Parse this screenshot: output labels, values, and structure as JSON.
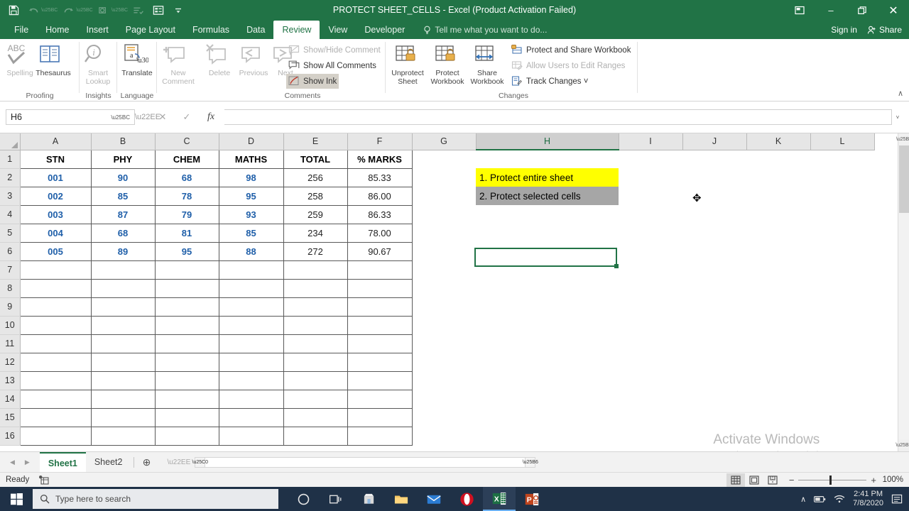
{
  "window": {
    "title": "PROTECT SHEET_CELLS - Excel (Product Activation Failed)",
    "minimize": "–",
    "restore": "❐",
    "close": "✕",
    "ribbon_display_options": "ribbon-display-options-icon"
  },
  "quick_access": [
    {
      "name": "save-icon",
      "glyph": "💾"
    },
    {
      "name": "undo-icon",
      "glyph": "↶"
    },
    {
      "name": "redo-icon",
      "glyph": "↷"
    },
    {
      "name": "touch-mode-icon",
      "glyph": "⬭"
    },
    {
      "name": "custom-sort-icon",
      "glyph": "≡"
    },
    {
      "name": "form-icon",
      "glyph": "▤"
    },
    {
      "name": "customize-qat-icon",
      "glyph": "⯆"
    }
  ],
  "tabs": [
    {
      "label": "File",
      "active": false
    },
    {
      "label": "Home",
      "active": false
    },
    {
      "label": "Insert",
      "active": false
    },
    {
      "label": "Page Layout",
      "active": false
    },
    {
      "label": "Formulas",
      "active": false
    },
    {
      "label": "Data",
      "active": false
    },
    {
      "label": "Review",
      "active": true
    },
    {
      "label": "View",
      "active": false
    },
    {
      "label": "Developer",
      "active": false
    }
  ],
  "tellme": "Tell me what you want to do...",
  "account": {
    "signin": "Sign in",
    "share": "Share"
  },
  "ribbon": {
    "groups": [
      {
        "label": "Proofing"
      },
      {
        "label": "Insights"
      },
      {
        "label": "Language"
      },
      {
        "label": "Comments"
      },
      {
        "label": "Changes"
      }
    ],
    "spelling": {
      "label": "Spelling",
      "sub": "ABC"
    },
    "thesaurus": {
      "label": "Thesaurus"
    },
    "smart_lookup": {
      "label": "Smart",
      "label2": "Lookup"
    },
    "translate": {
      "label": "Translate"
    },
    "new_comment": {
      "label": "New",
      "label2": "Comment"
    },
    "delete_comment": {
      "label": "Delete"
    },
    "previous_comment": {
      "label": "Previous"
    },
    "next_comment": {
      "label": "Next"
    },
    "show_hide_comment": {
      "label": "Show/Hide Comment"
    },
    "show_all_comments": {
      "label": "Show All Comments"
    },
    "show_ink": {
      "label": "Show Ink"
    },
    "unprotect_sheet": {
      "label": "Unprotect",
      "label2": "Sheet"
    },
    "protect_workbook": {
      "label": "Protect",
      "label2": "Workbook"
    },
    "share_workbook": {
      "label": "Share",
      "label2": "Workbook"
    },
    "protect_share_workbook": {
      "label": "Protect and Share Workbook"
    },
    "allow_users_edit_ranges": {
      "label": "Allow Users to Edit Ranges"
    },
    "track_changes": {
      "label": "Track Changes ˅"
    },
    "collapse": "∧"
  },
  "formula_bar": {
    "name_box_value": "H6",
    "cancel": "✕",
    "enter": "✓",
    "insert_function": "fx",
    "formula_value": "",
    "expand": "˅"
  },
  "grid": {
    "columns": [
      "A",
      "B",
      "C",
      "D",
      "E",
      "F",
      "G",
      "H",
      "I",
      "J",
      "K",
      "L"
    ],
    "selected_column": "H",
    "rows": [
      1,
      2,
      3,
      4,
      5,
      6,
      7,
      8,
      9,
      10,
      11,
      12,
      13,
      14,
      15,
      16
    ],
    "table_headers": [
      "STN",
      "PHY",
      "CHEM",
      "MATHS",
      "TOTAL",
      "% MARKS"
    ],
    "table_rows": [
      [
        "001",
        "90",
        "68",
        "98",
        "256",
        "85.33"
      ],
      [
        "002",
        "85",
        "78",
        "95",
        "258",
        "86.00"
      ],
      [
        "003",
        "87",
        "79",
        "93",
        "259",
        "86.33"
      ],
      [
        "004",
        "68",
        "81",
        "85",
        "234",
        "78.00"
      ],
      [
        "005",
        "89",
        "95",
        "88",
        "272",
        "90.67"
      ]
    ],
    "annotations": [
      {
        "cell": "H2",
        "text": "1. Protect entire sheet",
        "fill": "#FFFF00"
      },
      {
        "cell": "H3",
        "text": "2. Protect selected cells",
        "fill": "#A6A6A6"
      }
    ],
    "active_cell": "H6",
    "mouse_pointer": "✥"
  },
  "watermark": {
    "line1": "Activate Windows",
    "line2": "Go to Settings to activate Windows."
  },
  "sheet_tabs": {
    "prev": "◀",
    "next": "▶",
    "items": [
      {
        "label": "Sheet1",
        "active": true
      },
      {
        "label": "Sheet2",
        "active": false
      }
    ],
    "add": "⊕"
  },
  "status_bar": {
    "status": "Ready",
    "macro_icon": "macro-record-icon",
    "views": [
      {
        "name": "normal-view-icon",
        "active": true
      },
      {
        "name": "page-layout-view-icon",
        "active": false
      },
      {
        "name": "page-break-preview-icon",
        "active": false
      }
    ],
    "zoom_out": "−",
    "zoom_in": "+",
    "zoom_level": "100%"
  },
  "taskbar": {
    "start": "windows-start-icon",
    "search_placeholder": "Type here to search",
    "icons": [
      {
        "name": "cortana-icon"
      },
      {
        "name": "task-view-icon"
      },
      {
        "name": "microsoft-store-icon"
      },
      {
        "name": "file-explorer-icon"
      },
      {
        "name": "mail-icon"
      },
      {
        "name": "opera-browser-icon"
      },
      {
        "name": "excel-icon",
        "active": true
      },
      {
        "name": "powerpoint-icon"
      }
    ],
    "tray": {
      "expand": "∧",
      "battery": "battery-icon",
      "wifi": "wifi-icon",
      "time": "2:41 PM",
      "date": "7/8/2020",
      "notifications": "notification-icon"
    }
  }
}
